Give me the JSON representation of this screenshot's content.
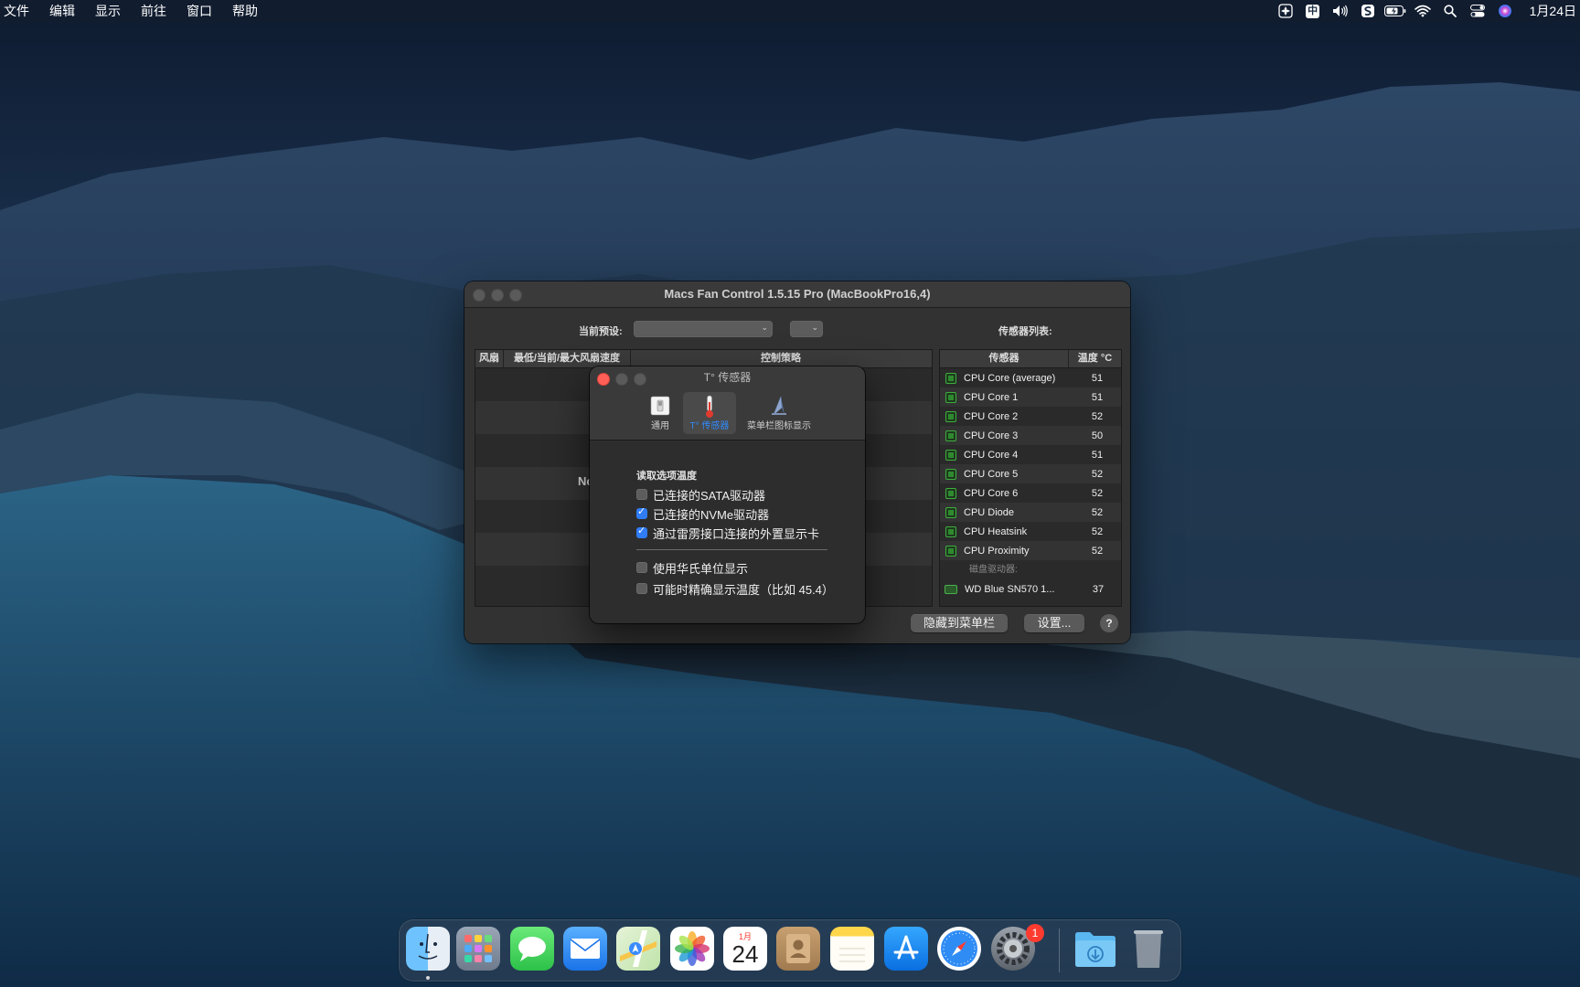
{
  "menubar": {
    "items": [
      "文件",
      "编辑",
      "显示",
      "前往",
      "窗口",
      "帮助"
    ],
    "status_icons": [
      "macs-fan-control-icon",
      "input-method-icon",
      "volume-icon",
      "app-s-icon",
      "battery-icon",
      "wifi-icon",
      "spotlight-icon",
      "control-center-icon",
      "siri-icon"
    ],
    "input_method_label": "中",
    "clock": "1月24日"
  },
  "main_window": {
    "title": "Macs Fan Control 1.5.15 Pro (MacBookPro16,4)",
    "preset_label": "当前预设:",
    "sensor_list_label": "传感器列表:",
    "fan_table": {
      "columns": [
        "风扇",
        "最低/当前/最大风扇速度",
        "控制策略"
      ],
      "empty_text": "No"
    },
    "sensor_table": {
      "columns": [
        "传感器",
        "温度 °C"
      ],
      "rows": [
        {
          "name": "CPU Core (average)",
          "temp": "51"
        },
        {
          "name": "CPU Core 1",
          "temp": "51"
        },
        {
          "name": "CPU Core 2",
          "temp": "52"
        },
        {
          "name": "CPU Core 3",
          "temp": "50"
        },
        {
          "name": "CPU Core 4",
          "temp": "51"
        },
        {
          "name": "CPU Core 5",
          "temp": "52"
        },
        {
          "name": "CPU Core 6",
          "temp": "52"
        },
        {
          "name": "CPU Diode",
          "temp": "52"
        },
        {
          "name": "CPU Heatsink",
          "temp": "52"
        },
        {
          "name": "CPU Proximity",
          "temp": "52"
        }
      ],
      "disk_group_label": "磁盘驱动器:",
      "disk_rows": [
        {
          "name": "WD Blue SN570 1...",
          "temp": "37"
        }
      ]
    },
    "buttons": {
      "hide_to_menubar": "隐藏到菜单栏",
      "settings": "设置...",
      "help": "?"
    }
  },
  "prefs_window": {
    "title": "T° 传感器",
    "tabs": [
      {
        "label": "通用",
        "icon": "general-switch-icon",
        "active": false
      },
      {
        "label": "T° 传感器",
        "icon": "thermometer-icon",
        "active": true
      },
      {
        "label": "菜单栏图标显示",
        "icon": "menubar-display-icon",
        "active": false
      }
    ],
    "section_title": "读取选项温度",
    "options": [
      {
        "label": "已连接的SATA驱动器",
        "checked": false
      },
      {
        "label": "已连接的NVMe驱动器",
        "checked": true
      },
      {
        "label": "通过雷雳接口连接的外置显示卡",
        "checked": true
      }
    ],
    "display_options": [
      {
        "label": "使用华氏单位显示",
        "checked": false
      },
      {
        "label": "可能时精确显示温度（比如 45.4）",
        "checked": false
      }
    ]
  },
  "dock": {
    "apps": [
      "Finder",
      "Launchpad",
      "Messages",
      "Mail",
      "Maps",
      "Photos",
      "Calendar",
      "Contacts",
      "Notes",
      "App Store",
      "Safari",
      "System Preferences"
    ],
    "calendar_month": "1月",
    "calendar_day": "24",
    "settings_badge": "1",
    "others": [
      "Downloads",
      "Trash"
    ]
  },
  "colors": {
    "accent": "#2f7cf6",
    "window_bg": "#323232",
    "sensor_chip": "#3fae3f",
    "close_red": "#ff5f57"
  }
}
